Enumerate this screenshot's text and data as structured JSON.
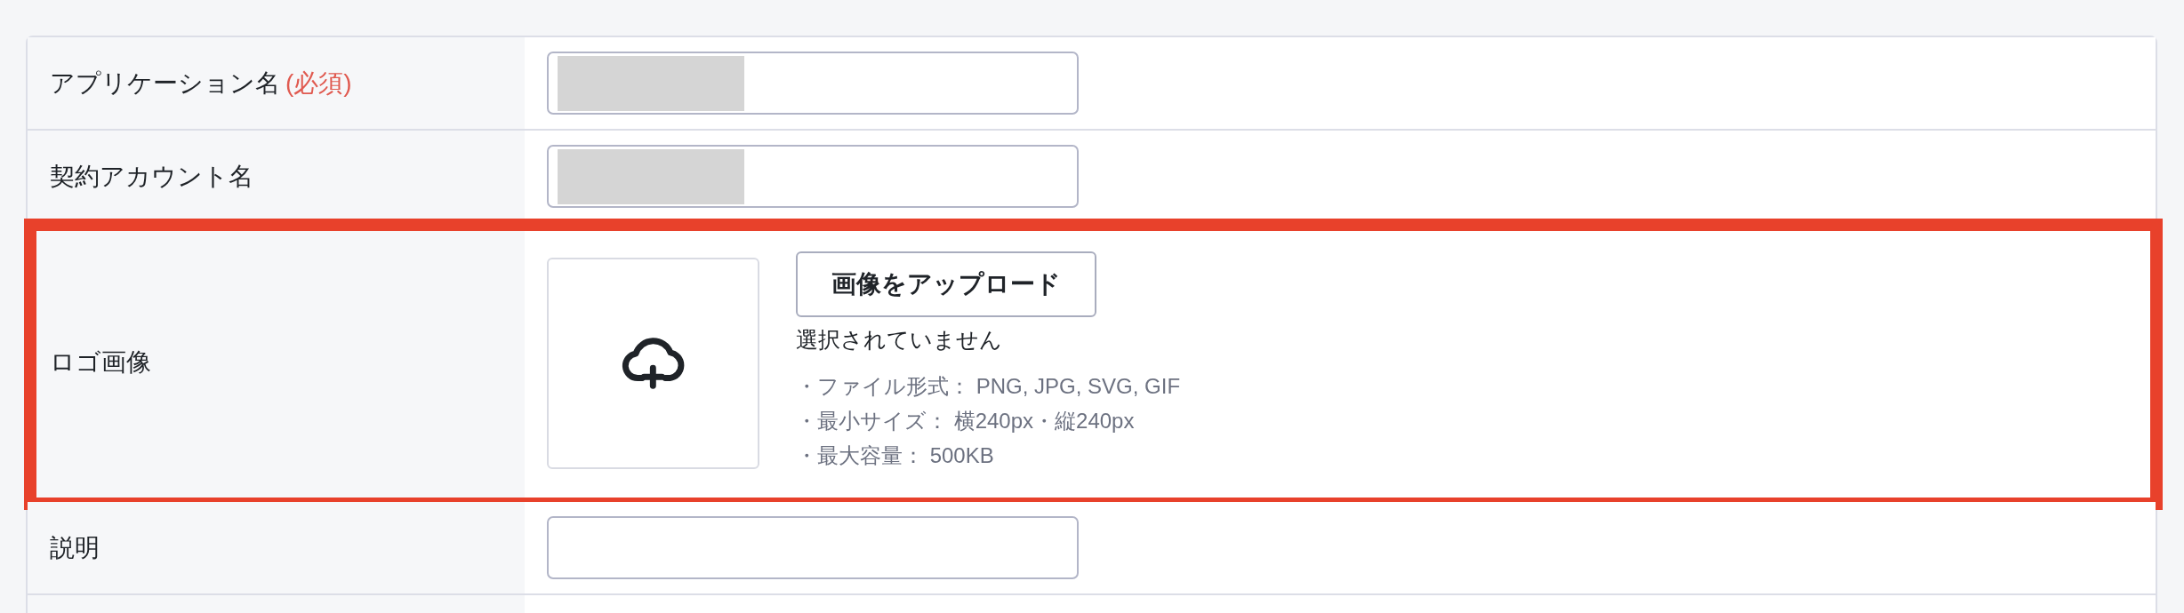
{
  "form": {
    "rows": [
      {
        "kind": "text",
        "label": "アプリケーション名",
        "required_mark": "(必須)",
        "redacted": true,
        "highlighted": false
      },
      {
        "kind": "text",
        "label": "契約アカウント名",
        "redacted": true,
        "highlighted": false
      },
      {
        "kind": "image_upload",
        "label": "ロゴ画像",
        "highlighted": true,
        "upload_button": "画像をアップロード",
        "file_status": "選択されていません",
        "notes": [
          "・ファイル形式： PNG, JPG, SVG, GIF",
          "・最小サイズ： 横240px・縦240px",
          "・最大容量： 500KB"
        ]
      },
      {
        "kind": "text",
        "label": "説明",
        "redacted": false,
        "highlighted": false
      }
    ]
  }
}
